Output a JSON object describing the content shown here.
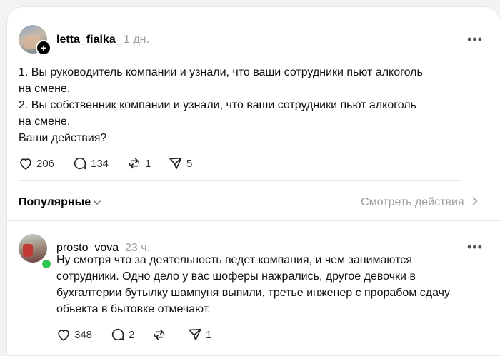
{
  "post": {
    "username": "letta_fialka_",
    "time": "1 дн.",
    "text": "1. Вы руководитель компании и узнали, что ваши сотрудники пьют алкоголь\nна смене.\n2. Вы собственник компании и узнали, что ваши сотрудники пьют алкоголь\nна смене.\nВаши действия?",
    "likes": "206",
    "replies": "134",
    "reposts": "1",
    "shares": "5",
    "more_label": "•••",
    "follow_badge": "+"
  },
  "sort": {
    "label": "Популярные",
    "activity_link": "Смотреть действия"
  },
  "reply": {
    "username": "prosto_vova",
    "time": "23 ч.",
    "text": "Ну смотря что за деятельность ведет компания, и чем занимаются\nсотрудники. Одно дело у вас шоферы нажрались, другое девочки в\nбухгалтерии бутылку шампуня выпили, третье инженер с прорабом сдачу\nобьекта в бытовке отмечают.",
    "likes": "348",
    "replies": "2",
    "reposts": "",
    "shares": "1",
    "more_label": "•••"
  },
  "icons": {
    "like": "heart-icon",
    "reply": "speech-bubble-icon",
    "repost": "repost-arrows-icon",
    "share": "paper-plane-icon",
    "more": "more-dots-icon",
    "chevron": "chevron-icon"
  },
  "colors": {
    "accent_online": "#2ec553",
    "muted_text": "#a0a0a0",
    "divider": "#e6e6e6"
  }
}
